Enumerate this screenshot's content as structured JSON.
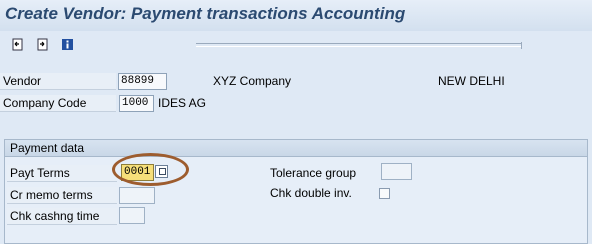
{
  "window": {
    "title": "Create Vendor: Payment transactions Accounting"
  },
  "toolbar": {
    "icons": [
      "previous-screen-icon",
      "next-screen-icon",
      "info-icon"
    ]
  },
  "header": {
    "vendor_label": "Vendor",
    "vendor_value": "88899",
    "vendor_name": "XYZ Company",
    "vendor_city": "NEW DELHI",
    "company_code_label": "Company Code",
    "company_code_value": "1000",
    "company_name": "IDES AG"
  },
  "payment_data": {
    "title": "Payment data",
    "payt_terms_label": "Payt Terms",
    "payt_terms_value": "0001",
    "cr_memo_terms_label": "Cr memo terms",
    "chk_cashng_time_label": "Chk cashng time",
    "tolerance_group_label": "Tolerance group",
    "chk_double_inv_label": "Chk double inv."
  },
  "colors": {
    "title": "#2b4a71",
    "background": "#dfe9f5",
    "highlight": "#9d5c2e",
    "active_field": "#f6df7a"
  }
}
